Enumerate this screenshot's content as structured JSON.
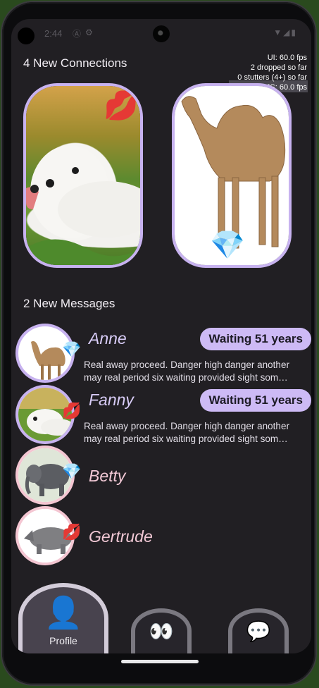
{
  "status_bar": {
    "time": "2:44",
    "icons": [
      "android-a-icon",
      "gear-icon",
      "wifi-icon",
      "signal-icon",
      "battery-icon"
    ]
  },
  "perf_overlay": {
    "ui_fps": "UI: 60.0 fps",
    "dropped": "2 dropped so far",
    "stutters": "0 stutters (4+) so far",
    "js_fps": "JS: 60.0 fps"
  },
  "connections": {
    "title": "4 New Connections",
    "cards": [
      {
        "animal": "Samoyed dog",
        "badge": "💋"
      },
      {
        "animal": "Camel",
        "badge": "💎"
      }
    ]
  },
  "messages": {
    "title": "2 New Messages",
    "items": [
      {
        "name": "Anne",
        "badge": "💎",
        "waiting": "Waiting 51 years",
        "preview_line1": "Real away proceed. Danger high danger another",
        "preview_line2": "may real period six waiting provided sight som…"
      },
      {
        "name": "Fanny",
        "badge": "💋",
        "waiting": "Waiting 51 years",
        "preview_line1": "Real away proceed. Danger high danger another",
        "preview_line2": "may real period six waiting provided sight som…"
      },
      {
        "name": "Betty",
        "badge": "💎"
      },
      {
        "name": "Gertrude",
        "badge": "💋"
      }
    ]
  },
  "nav": {
    "profile": {
      "label": "Profile",
      "icon": "👤"
    },
    "discover": {
      "icon": "👀"
    },
    "chats": {
      "icon": "💬"
    }
  },
  "colors": {
    "accent_purple": "#c7b2ef",
    "accent_pink": "#f4c6d2",
    "background": "#211f23"
  }
}
